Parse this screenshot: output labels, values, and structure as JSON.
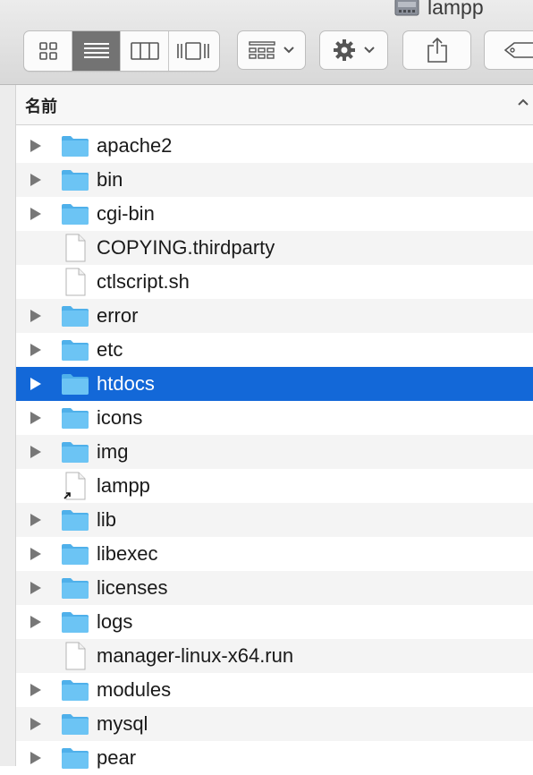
{
  "window": {
    "title": "lampp"
  },
  "toolbar": {
    "view_modes": [
      "icon-view",
      "list-view",
      "column-view",
      "cover-flow-view"
    ],
    "active_view": "list-view",
    "buttons": [
      "arrange",
      "action",
      "share",
      "tags"
    ]
  },
  "header": {
    "name_column": "名前",
    "sort": "ascending"
  },
  "files": [
    {
      "name": "apache2",
      "kind": "folder",
      "expandable": true
    },
    {
      "name": "bin",
      "kind": "folder",
      "expandable": true
    },
    {
      "name": "cgi-bin",
      "kind": "folder",
      "expandable": true
    },
    {
      "name": "COPYING.thirdparty",
      "kind": "document",
      "expandable": false
    },
    {
      "name": "ctlscript.sh",
      "kind": "document",
      "expandable": false
    },
    {
      "name": "error",
      "kind": "folder",
      "expandable": true
    },
    {
      "name": "etc",
      "kind": "folder",
      "expandable": true
    },
    {
      "name": "htdocs",
      "kind": "folder",
      "expandable": true,
      "selected": true
    },
    {
      "name": "icons",
      "kind": "folder",
      "expandable": true
    },
    {
      "name": "img",
      "kind": "folder",
      "expandable": true
    },
    {
      "name": "lampp",
      "kind": "alias",
      "expandable": false
    },
    {
      "name": "lib",
      "kind": "folder",
      "expandable": true
    },
    {
      "name": "libexec",
      "kind": "folder",
      "expandable": true
    },
    {
      "name": "licenses",
      "kind": "folder",
      "expandable": true
    },
    {
      "name": "logs",
      "kind": "folder",
      "expandable": true
    },
    {
      "name": "manager-linux-x64.run",
      "kind": "document",
      "expandable": false
    },
    {
      "name": "modules",
      "kind": "folder",
      "expandable": true
    },
    {
      "name": "mysql",
      "kind": "folder",
      "expandable": true
    },
    {
      "name": "pear",
      "kind": "folder",
      "expandable": true
    }
  ],
  "colors": {
    "selection": "#1368d8",
    "folder": "#6cc4f4",
    "alt_row": "#f4f4f4"
  }
}
